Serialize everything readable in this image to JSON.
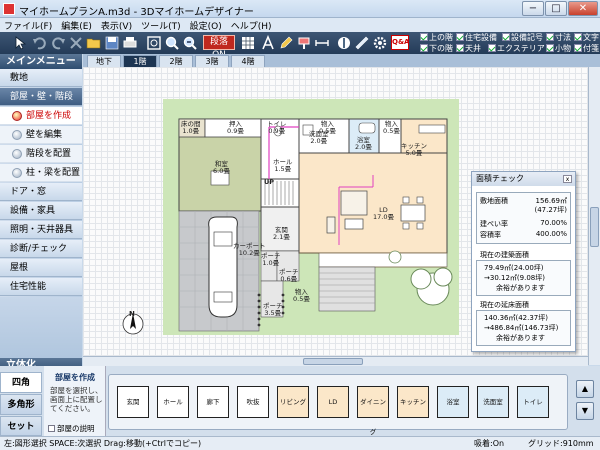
{
  "window": {
    "title": "マイホームプランA.m3d - 3Dマイホームデザイナー",
    "minimize": "−",
    "maximize": "□",
    "close": "✕"
  },
  "menu": [
    "ファイル(F)",
    "編集(E)",
    "表示(V)",
    "ツール(T)",
    "設定(O)",
    "ヘルプ(H)"
  ],
  "toolbar": {
    "dankaku_label": "段落 ON",
    "qna_label": "Q&A"
  },
  "checks": [
    {
      "label": "上の階",
      "checked": true
    },
    {
      "label": "住宅設備",
      "checked": true
    },
    {
      "label": "設備記号",
      "checked": true
    },
    {
      "label": "寸法",
      "checked": true
    },
    {
      "label": "文字",
      "checked": true
    },
    {
      "label": "下の階",
      "checked": true
    },
    {
      "label": "天井",
      "checked": true
    },
    {
      "label": "エクステリア",
      "checked": true
    },
    {
      "label": "小物",
      "checked": true
    },
    {
      "label": "付箋",
      "checked": true
    }
  ],
  "sidebar": {
    "title": "メインメニュー",
    "items": [
      {
        "label": "敷地"
      },
      {
        "label": "部屋・壁・階段",
        "selected": true
      },
      {
        "label": "部屋を作成",
        "sub": true,
        "active": true
      },
      {
        "label": "壁を編集",
        "sub": true
      },
      {
        "label": "階段を配置",
        "sub": true
      },
      {
        "label": "柱・梁を配置",
        "sub": true
      },
      {
        "label": "ドア・窓"
      },
      {
        "label": "設備・家具"
      },
      {
        "label": "照明・天井器具"
      },
      {
        "label": "診断/チェック"
      },
      {
        "label": "屋根"
      },
      {
        "label": "住宅性能"
      }
    ],
    "threed_label": "立体化"
  },
  "floor_tabs": [
    "地下",
    "1階",
    "2階",
    "3階",
    "4階"
  ],
  "active_floor": "1階",
  "plan": {
    "rooms": [
      {
        "name": "床の間",
        "size": "1.0畳"
      },
      {
        "name": "押入",
        "size": "0.9畳"
      },
      {
        "name": "トイレ",
        "size": "0.9畳"
      },
      {
        "name": "洗面室",
        "size": "2.0畳"
      },
      {
        "name": "浴室",
        "size": "2.0畳"
      },
      {
        "name": "物入",
        "size": "0.5畳"
      },
      {
        "name": "物入",
        "size": "0.5畳"
      },
      {
        "name": "和室",
        "size": "6.0畳"
      },
      {
        "name": "キッチン",
        "size": "5.0畳"
      },
      {
        "name": "LD",
        "size": "17.0畳"
      },
      {
        "name": "玄関",
        "size": "2.1畳"
      },
      {
        "name": "ホール",
        "size": "1.5畳"
      },
      {
        "name": "カーポート",
        "size": "10.2畳"
      },
      {
        "name": "ポーチ",
        "size": "1.0畳"
      },
      {
        "name": "ポーチ",
        "size": "0.6畳"
      },
      {
        "name": "ポーチ",
        "size": "3.5畳"
      },
      {
        "name": "物入",
        "size": "0.5畳"
      }
    ],
    "stair_label": "UP",
    "compass_label": "N"
  },
  "check_panel": {
    "title": "面積チェック",
    "rows": [
      {
        "label": "敷地面積",
        "value": "156.69㎡",
        "sub": "(47.27坪)"
      },
      {
        "label": "建ぺい率",
        "value": "70.00%"
      },
      {
        "label": "容積率",
        "value": "400.00%"
      }
    ],
    "building_title": "現在の建築面積",
    "building_value": "79.49㎡(24.00坪)",
    "building_delta": "→30.12㎡(9.08坪)",
    "building_note": "余裕があります",
    "floor_title": "現在の延床面積",
    "floor_value": "140.36㎡(42.37坪)",
    "floor_delta": "→486.84㎡(146.73坪)",
    "floor_note": "余裕があります"
  },
  "shape_tabs": [
    "四角",
    "多角形",
    "セット"
  ],
  "help": {
    "title": "部屋を作成",
    "body": "部屋を選択し、画面上に配置してください。",
    "checkbox": "部屋の説明"
  },
  "palette": [
    "玄関",
    "ホール",
    "廊下",
    "吹抜",
    "リビング",
    "LD",
    "ダイニング",
    "キッチン",
    "浴室",
    "洗面室",
    "トイレ"
  ],
  "status": {
    "left": "左:図形選択 SPACE:次選択 Drag:移動(+Ctrlでコピー)",
    "snap": "吸着:On",
    "grid": "グリッド:910mm"
  },
  "colors": {
    "toolbar": "#243b58",
    "accent_red": "#c0281e",
    "wood_floor": "#fbe7c9",
    "tatami": "#c9d3a8",
    "garden": "#cde6b8"
  }
}
